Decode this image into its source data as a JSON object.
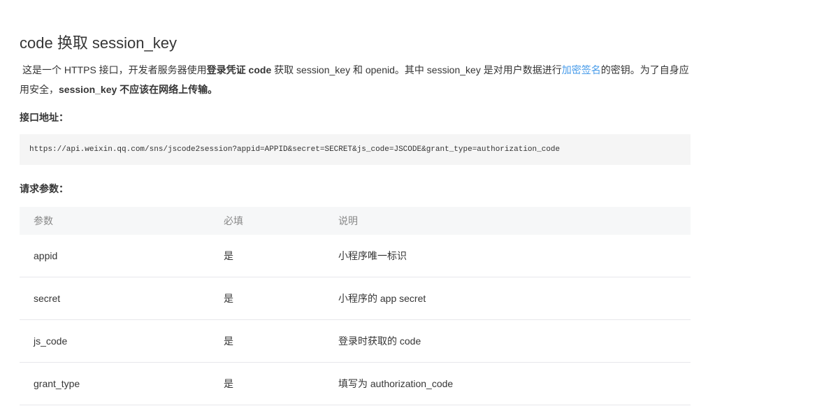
{
  "title": "code 换取 session_key",
  "intro": {
    "t1": "这是一个 HTTPS 接口，开发者服务器使用",
    "b1": "登录凭证 code",
    "t2": " 获取 session_key 和 openid。其中 session_key 是对用户数据进行",
    "link": "加密签名",
    "t3": "的密钥。为了自身应用安全，",
    "b2": "session_key 不应该在网络上传输。"
  },
  "endpoint_label": "接口地址：",
  "endpoint_url": "https://api.weixin.qq.com/sns/jscode2session?appid=APPID&secret=SECRET&js_code=JSCODE&grant_type=authorization_code",
  "params_label": "请求参数：",
  "table": {
    "headers": [
      "参数",
      "必填",
      "说明"
    ],
    "rows": [
      [
        "appid",
        "是",
        "小程序唯一标识"
      ],
      [
        "secret",
        "是",
        "小程序的 app secret"
      ],
      [
        "js_code",
        "是",
        "登录时获取的 code"
      ],
      [
        "grant_type",
        "是",
        "填写为 authorization_code"
      ]
    ]
  }
}
